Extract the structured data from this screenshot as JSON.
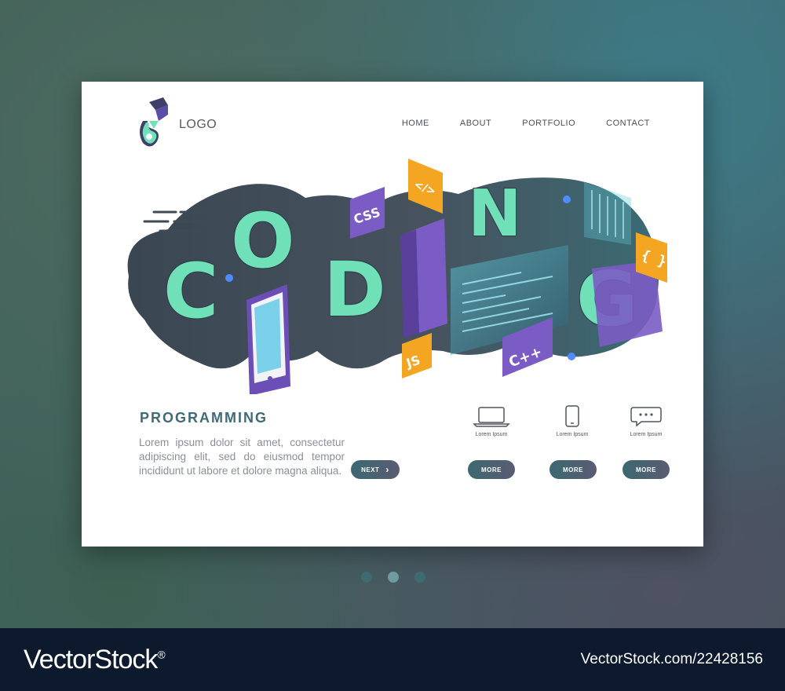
{
  "header": {
    "logo_text": "LOGO",
    "nav": [
      "HOME",
      "ABOUT",
      "PORTFOLIO",
      "CONTACT"
    ]
  },
  "hero": {
    "letters": [
      "C",
      "O",
      "D",
      "I",
      "N",
      "G"
    ],
    "tags": {
      "css": "CSS",
      "html": "</>",
      "braces": "{ }",
      "js": "JS",
      "cpp": "C++"
    }
  },
  "section": {
    "title": "PROGRAMMING",
    "text": "Lorem ipsum dolor sit amet, consectetur adipiscing elit, sed do eiusmod tempor incididunt ut labore et dolore magna aliqua.",
    "next_label": "NEXT"
  },
  "features": [
    {
      "icon": "laptop-icon",
      "label": "Lorem Ipsum",
      "button": "MORE"
    },
    {
      "icon": "smartphone-icon",
      "label": "Lorem Ipsum",
      "button": "MORE"
    },
    {
      "icon": "chat-bubble-icon",
      "label": "Lorem Ipsum",
      "button": "MORE"
    }
  ],
  "pagination": {
    "count": 3,
    "active": 2
  },
  "watermark": {
    "brand": "VectorStock",
    "reg": "®",
    "asset": "VectorStock.com/22428156"
  },
  "colors": {
    "mint": "#6fe0b8",
    "purple": "#7b5cc4",
    "orange": "#f4a623",
    "dark": "#3e4a55",
    "teal": "#3f6a78"
  }
}
